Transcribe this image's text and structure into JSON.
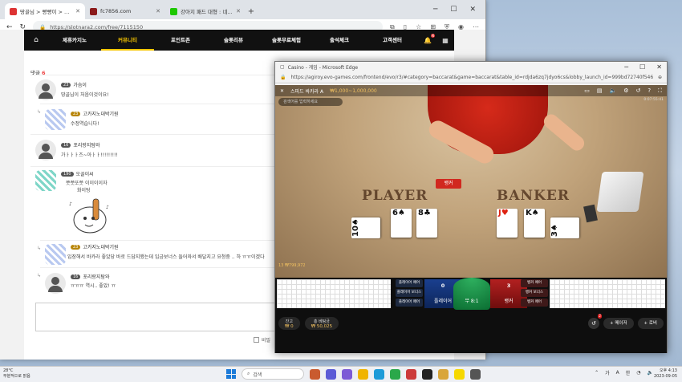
{
  "browser": {
    "tabs": [
      {
        "label": "땅골님 > 빵빵이 > 가슴이 > 입갈",
        "fav": "#d33"
      },
      {
        "label": "fc7856.com",
        "fav": "#8b1a1a"
      },
      {
        "label": "강아지 패드 대형 : 네이버 통합검",
        "fav": "#1ec800"
      }
    ],
    "url": "https://slotnara2.com/free/7115150",
    "site_menu": [
      "제휴카지노",
      "커뮤니티",
      "포인트존",
      "슬롯리뷰",
      "슬롯무료체험",
      "출석체크",
      "고객센터"
    ],
    "notif_badge": "N",
    "side_tags": [
      "비판",
      "지원"
    ]
  },
  "comments": {
    "header": "댓글",
    "count": "6",
    "items": [
      {
        "level": "23",
        "name": "가슴이",
        "text": "땅골님이 처음이것이요!",
        "reply": false
      },
      {
        "level": "23",
        "name": "고카지노대박기원",
        "text": "수정역습니다!",
        "reply": true
      },
      {
        "level": "16",
        "name": "포리랑지탐와",
        "text": "가ㅏㅏㅏ즈~아ㅏㅏ!!!!!!!!!",
        "reply": false
      },
      {
        "level": "190",
        "name": "오골이씨",
        "text": "쯧쯧또쯧 이이이이자",
        "text2": "화이팅",
        "reply": false
      },
      {
        "level": "23",
        "name": "고카지노대박기원",
        "text": "입장해서 바카라 좋았당 바로 드담지했는데 입금보너스 들어와서 배달지고 요청중 .. 하 ㅠㅠ이겠다",
        "reply": true
      },
      {
        "level": "16",
        "name": "포리랑지탐와",
        "text": "ㅠㅠㅠ 역시.. 좋았! ㅠ",
        "reply": true
      }
    ],
    "secret_label": "비밀"
  },
  "casino": {
    "title": "Casino - 게임 - Microsoft Edge",
    "url": "https://agiroy.evo-games.com/frontend/evo/r3/#category=baccarat&game=baccarat&table_id=rdjda6zq7jdyo6cs&lobby_launch_id=999bd72740f54693b3d7a7...",
    "table_name": "스피드 바카라 A",
    "limits": "₩1,000~1,000,000",
    "search_hint": "검색어를 입력하세요",
    "player_label": "PLAYER",
    "banker_label": "BANKER",
    "winner_tag": "뱅커",
    "player_cards": [
      "10♠",
      "6♠",
      "8♣"
    ],
    "banker_cards": [
      "J♥",
      "K♠",
      "3♠"
    ],
    "balance_strip": "13 ₩799,972",
    "side_bets_left": [
      "플레이어 페어",
      "플레이어 보너스",
      "플레이어 페어"
    ],
    "side_bets_right": [
      "뱅커 페어",
      "뱅커 보너스",
      "뱅커 페어"
    ],
    "player_bet": {
      "num": "0",
      "label": "플레이어"
    },
    "tie_bet": {
      "label": "무 8:1"
    },
    "banker_bet": {
      "num": "3",
      "label": "뱅커"
    },
    "balance_label": "잔고",
    "balance_value": "₩ 0",
    "total_bet_label": "총 베팅금",
    "total_bet_value": "₩ 50,025",
    "chat_badge": "2",
    "btn_lobby": "+ 로비",
    "btn_more": "+ 메이저",
    "topbar_time": "0:07:55:41"
  },
  "taskbar": {
    "weather_temp": "28°C",
    "weather_text": "부분적으로 맑음",
    "search_label": "검색",
    "time": "오후 4:13",
    "date": "2023-09-05",
    "lang": "가",
    "ime": "A",
    "han": "한"
  }
}
